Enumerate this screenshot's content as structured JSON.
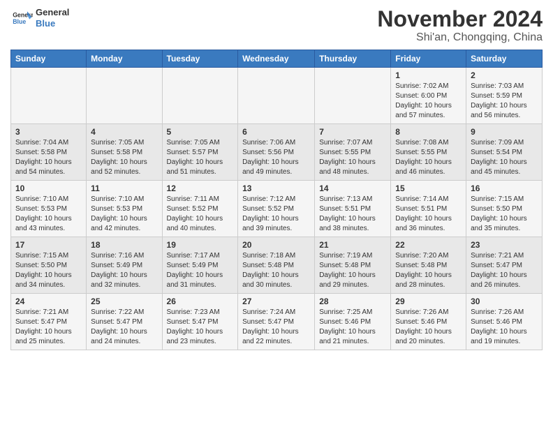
{
  "logo": {
    "line1": "General",
    "line2": "Blue"
  },
  "title": "November 2024",
  "subtitle": "Shi'an, Chongqing, China",
  "weekdays": [
    "Sunday",
    "Monday",
    "Tuesday",
    "Wednesday",
    "Thursday",
    "Friday",
    "Saturday"
  ],
  "weeks": [
    [
      {
        "day": "",
        "info": ""
      },
      {
        "day": "",
        "info": ""
      },
      {
        "day": "",
        "info": ""
      },
      {
        "day": "",
        "info": ""
      },
      {
        "day": "",
        "info": ""
      },
      {
        "day": "1",
        "info": "Sunrise: 7:02 AM\nSunset: 6:00 PM\nDaylight: 10 hours and 57 minutes."
      },
      {
        "day": "2",
        "info": "Sunrise: 7:03 AM\nSunset: 5:59 PM\nDaylight: 10 hours and 56 minutes."
      }
    ],
    [
      {
        "day": "3",
        "info": "Sunrise: 7:04 AM\nSunset: 5:58 PM\nDaylight: 10 hours and 54 minutes."
      },
      {
        "day": "4",
        "info": "Sunrise: 7:05 AM\nSunset: 5:58 PM\nDaylight: 10 hours and 52 minutes."
      },
      {
        "day": "5",
        "info": "Sunrise: 7:05 AM\nSunset: 5:57 PM\nDaylight: 10 hours and 51 minutes."
      },
      {
        "day": "6",
        "info": "Sunrise: 7:06 AM\nSunset: 5:56 PM\nDaylight: 10 hours and 49 minutes."
      },
      {
        "day": "7",
        "info": "Sunrise: 7:07 AM\nSunset: 5:55 PM\nDaylight: 10 hours and 48 minutes."
      },
      {
        "day": "8",
        "info": "Sunrise: 7:08 AM\nSunset: 5:55 PM\nDaylight: 10 hours and 46 minutes."
      },
      {
        "day": "9",
        "info": "Sunrise: 7:09 AM\nSunset: 5:54 PM\nDaylight: 10 hours and 45 minutes."
      }
    ],
    [
      {
        "day": "10",
        "info": "Sunrise: 7:10 AM\nSunset: 5:53 PM\nDaylight: 10 hours and 43 minutes."
      },
      {
        "day": "11",
        "info": "Sunrise: 7:10 AM\nSunset: 5:53 PM\nDaylight: 10 hours and 42 minutes."
      },
      {
        "day": "12",
        "info": "Sunrise: 7:11 AM\nSunset: 5:52 PM\nDaylight: 10 hours and 40 minutes."
      },
      {
        "day": "13",
        "info": "Sunrise: 7:12 AM\nSunset: 5:52 PM\nDaylight: 10 hours and 39 minutes."
      },
      {
        "day": "14",
        "info": "Sunrise: 7:13 AM\nSunset: 5:51 PM\nDaylight: 10 hours and 38 minutes."
      },
      {
        "day": "15",
        "info": "Sunrise: 7:14 AM\nSunset: 5:51 PM\nDaylight: 10 hours and 36 minutes."
      },
      {
        "day": "16",
        "info": "Sunrise: 7:15 AM\nSunset: 5:50 PM\nDaylight: 10 hours and 35 minutes."
      }
    ],
    [
      {
        "day": "17",
        "info": "Sunrise: 7:15 AM\nSunset: 5:50 PM\nDaylight: 10 hours and 34 minutes."
      },
      {
        "day": "18",
        "info": "Sunrise: 7:16 AM\nSunset: 5:49 PM\nDaylight: 10 hours and 32 minutes."
      },
      {
        "day": "19",
        "info": "Sunrise: 7:17 AM\nSunset: 5:49 PM\nDaylight: 10 hours and 31 minutes."
      },
      {
        "day": "20",
        "info": "Sunrise: 7:18 AM\nSunset: 5:48 PM\nDaylight: 10 hours and 30 minutes."
      },
      {
        "day": "21",
        "info": "Sunrise: 7:19 AM\nSunset: 5:48 PM\nDaylight: 10 hours and 29 minutes."
      },
      {
        "day": "22",
        "info": "Sunrise: 7:20 AM\nSunset: 5:48 PM\nDaylight: 10 hours and 28 minutes."
      },
      {
        "day": "23",
        "info": "Sunrise: 7:21 AM\nSunset: 5:47 PM\nDaylight: 10 hours and 26 minutes."
      }
    ],
    [
      {
        "day": "24",
        "info": "Sunrise: 7:21 AM\nSunset: 5:47 PM\nDaylight: 10 hours and 25 minutes."
      },
      {
        "day": "25",
        "info": "Sunrise: 7:22 AM\nSunset: 5:47 PM\nDaylight: 10 hours and 24 minutes."
      },
      {
        "day": "26",
        "info": "Sunrise: 7:23 AM\nSunset: 5:47 PM\nDaylight: 10 hours and 23 minutes."
      },
      {
        "day": "27",
        "info": "Sunrise: 7:24 AM\nSunset: 5:47 PM\nDaylight: 10 hours and 22 minutes."
      },
      {
        "day": "28",
        "info": "Sunrise: 7:25 AM\nSunset: 5:46 PM\nDaylight: 10 hours and 21 minutes."
      },
      {
        "day": "29",
        "info": "Sunrise: 7:26 AM\nSunset: 5:46 PM\nDaylight: 10 hours and 20 minutes."
      },
      {
        "day": "30",
        "info": "Sunrise: 7:26 AM\nSunset: 5:46 PM\nDaylight: 10 hours and 19 minutes."
      }
    ]
  ]
}
